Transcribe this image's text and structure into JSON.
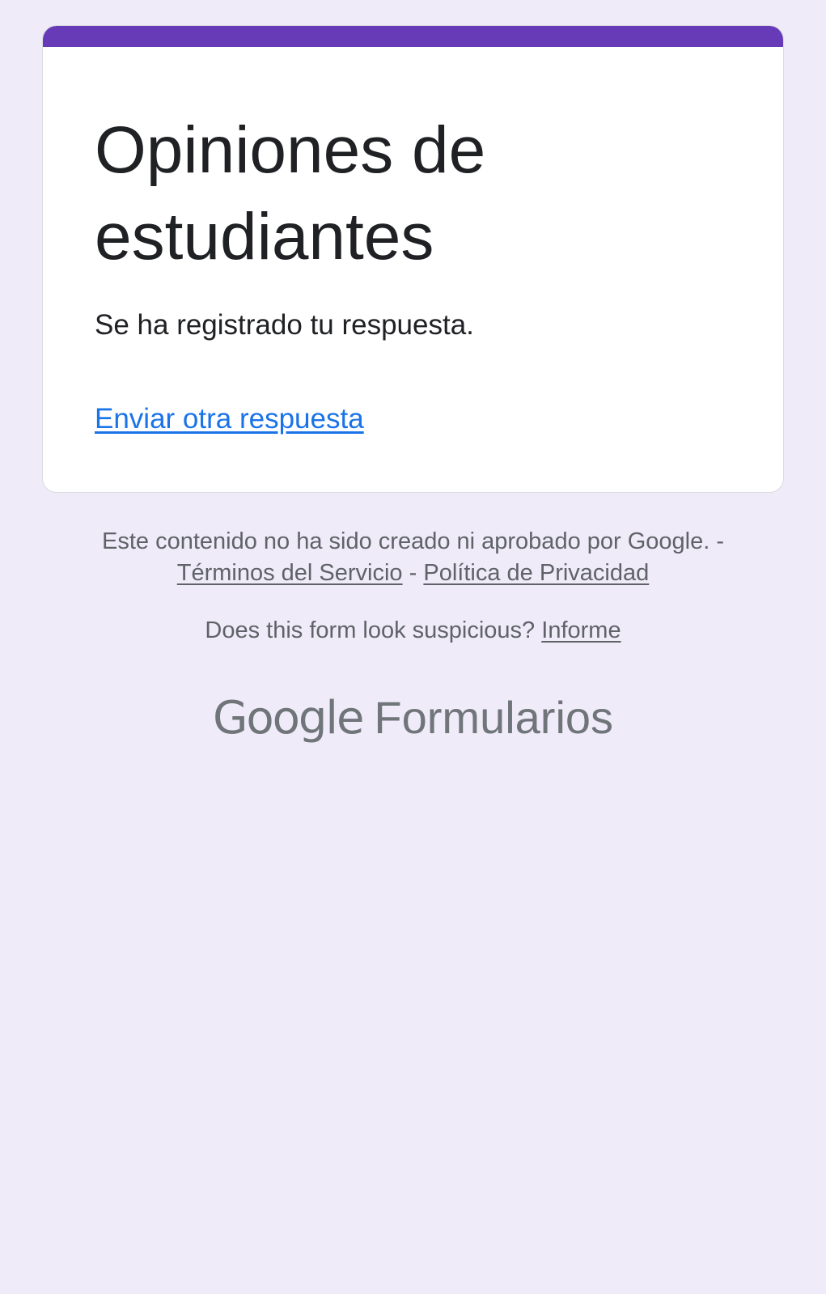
{
  "colors": {
    "page_background": "#efebf8",
    "accent": "#673ab7",
    "link": "#1a73e8",
    "footer_text": "#5f6368"
  },
  "form": {
    "title": "Opiniones de estudiantes",
    "confirmation_message": "Se ha registrado tu respuesta.",
    "submit_another_label": "Enviar otra respuesta"
  },
  "footer": {
    "disclaimer": "Este contenido no ha sido creado ni aprobado por Google. -",
    "terms_label": "Términos del Servicio",
    "separator": "-",
    "privacy_label": "Política de Privacidad",
    "suspicious_text": "Does this form look suspicious?",
    "report_label": "Informe"
  },
  "brand": {
    "google": "Google",
    "product": "Formularios"
  }
}
